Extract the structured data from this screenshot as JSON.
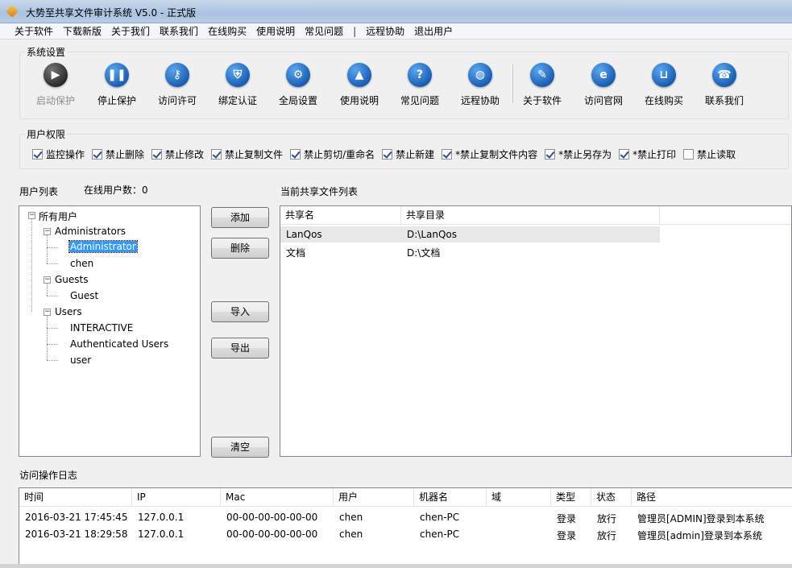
{
  "window": {
    "title": "大势至共享文件审计系统 V5.0 - 正式版"
  },
  "menu": [
    "关于软件",
    "下载新版",
    "关于我们",
    "联系我们",
    "在线购买",
    "使用说明",
    "常见问题",
    "|",
    "远程协助",
    "退出用户"
  ],
  "system_settings": {
    "label": "系统设置",
    "tools": [
      {
        "label": "启动保护",
        "icon": "play-icon",
        "glyph": "▶",
        "disabled": true
      },
      {
        "label": "停止保护",
        "icon": "pause-icon",
        "glyph": "❚❚",
        "disabled": false
      },
      {
        "label": "访问许可",
        "icon": "key-icon",
        "glyph": "⚷",
        "disabled": false
      },
      {
        "label": "绑定认证",
        "icon": "shield-icon",
        "glyph": "⛨",
        "disabled": false
      },
      {
        "label": "全局设置",
        "icon": "gear-icon",
        "glyph": "⚙",
        "disabled": false
      },
      {
        "label": "使用说明",
        "icon": "graduation-cap-icon",
        "glyph": "🎓",
        "disabled": false
      },
      {
        "label": "常见问题",
        "icon": "question-icon",
        "glyph": "?",
        "disabled": false
      },
      {
        "label": "远程协助",
        "icon": "globe-icon",
        "glyph": "◍",
        "disabled": false
      },
      {
        "label": "关于软件",
        "icon": "edit-icon",
        "glyph": "✎",
        "disabled": false
      },
      {
        "label": "访问官网",
        "icon": "browser-icon",
        "glyph": "e",
        "disabled": false
      },
      {
        "label": "在线购买",
        "icon": "cart-icon",
        "glyph": "🛒",
        "disabled": false
      },
      {
        "label": "联系我们",
        "icon": "phone-icon",
        "glyph": "☎",
        "disabled": false
      }
    ]
  },
  "permissions": {
    "label": "用户权限",
    "items": [
      {
        "label": "监控操作",
        "checked": true
      },
      {
        "label": "禁止删除",
        "checked": true
      },
      {
        "label": "禁止修改",
        "checked": true
      },
      {
        "label": "禁止复制文件",
        "checked": true
      },
      {
        "label": "禁止剪切/重命名",
        "checked": true
      },
      {
        "label": "禁止新建",
        "checked": true
      },
      {
        "label": "*禁止复制文件内容",
        "checked": true
      },
      {
        "label": "*禁止另存为",
        "checked": true
      },
      {
        "label": "*禁止打印",
        "checked": true
      },
      {
        "label": "禁止读取",
        "checked": false
      }
    ]
  },
  "users": {
    "label": "用户列表",
    "online": "在线用户数：0",
    "root": "所有用户",
    "groups": [
      {
        "name": "Administrators",
        "members": [
          "Administrator",
          "chen"
        ]
      },
      {
        "name": "Guests",
        "members": [
          "Guest"
        ]
      },
      {
        "name": "Users",
        "members": [
          "INTERACTIVE",
          "Authenticated Users",
          "user"
        ]
      }
    ],
    "selected": "Administrator"
  },
  "buttons": {
    "add": "添加",
    "delete": "删除",
    "import": "导入",
    "export": "导出",
    "clear": "清空"
  },
  "shares": {
    "label": "当前共享文件列表",
    "headers": [
      "共享名",
      "共享目录"
    ],
    "rows": [
      [
        "LanQos",
        "D:\\LanQos"
      ],
      [
        "文档",
        "D:\\文档"
      ]
    ]
  },
  "log": {
    "label": "访问操作日志",
    "headers": [
      "时间",
      "IP",
      "Mac",
      "用户",
      "机器名",
      "域",
      "类型",
      "状态",
      "路径"
    ],
    "rows": [
      [
        "2016-03-21 17:45:45",
        "127.0.0.1",
        "00-00-00-00-00-00",
        "chen",
        "chen-PC",
        "",
        "登录",
        "放行",
        "管理员[ADMIN]登录到本系统"
      ],
      [
        "2016-03-21 18:29:58",
        "127.0.0.1",
        "00-00-00-00-00-00",
        "chen",
        "chen-PC",
        "",
        "登录",
        "放行",
        "管理员[admin]登录到本系统"
      ]
    ]
  }
}
